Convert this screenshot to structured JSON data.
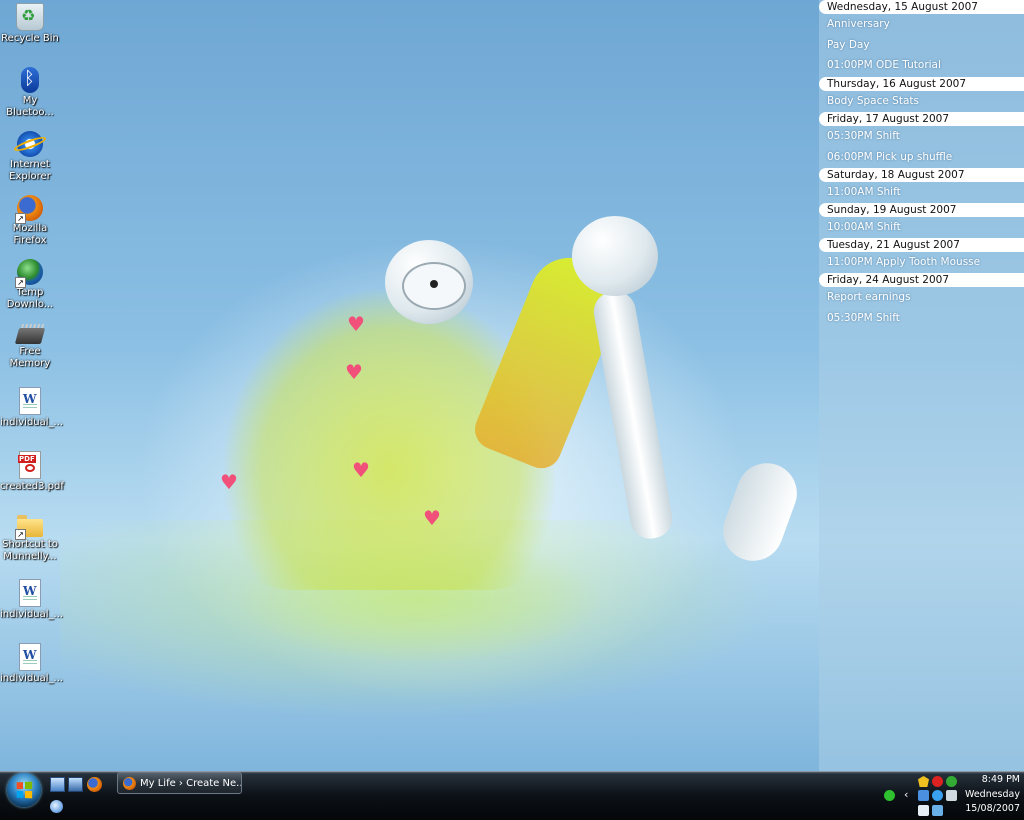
{
  "desktop_icons": [
    {
      "label": "Recycle Bin",
      "icon": "recycle-bin-icon"
    },
    {
      "label": "My\nBluetoo...",
      "icon": "bluetooth-icon"
    },
    {
      "label": "Internet\nExplorer",
      "icon": "internet-explorer-icon"
    },
    {
      "label": "Mozilla\nFirefox",
      "icon": "firefox-icon"
    },
    {
      "label": "Temp\nDownlo...",
      "icon": "globe-icon"
    },
    {
      "label": "Free Memory",
      "icon": "memory-chip-icon"
    },
    {
      "label": "individual_...",
      "icon": "word-document-icon"
    },
    {
      "label": "created3.pdf",
      "icon": "pdf-document-icon"
    },
    {
      "label": "Shortcut to\nMunnelly...",
      "icon": "folder-icon"
    },
    {
      "label": "individual_...",
      "icon": "word-document-icon"
    },
    {
      "label": "individual_...",
      "icon": "word-document-icon"
    }
  ],
  "calendar": [
    {
      "date": "Wednesday, 15 August 2007",
      "events": [
        "Anniversary",
        "Pay Day",
        "01:00PM ODE Tutorial"
      ]
    },
    {
      "date": "Thursday, 16 August 2007",
      "events": [
        "Body Space Stats"
      ]
    },
    {
      "date": "Friday, 17 August 2007",
      "events": [
        "05:30PM Shift",
        "06:00PM Pick up shuffle"
      ]
    },
    {
      "date": "Saturday, 18 August 2007",
      "events": [
        "11:00AM Shift"
      ]
    },
    {
      "date": "Sunday, 19 August 2007",
      "events": [
        "10:00AM Shift"
      ]
    },
    {
      "date": "Tuesday, 21 August 2007",
      "events": [
        "11:00PM Apply Tooth Mousse"
      ]
    },
    {
      "date": "Friday, 24 August 2007",
      "events": [
        "Report earnings",
        "05:30PM Shift"
      ]
    }
  ],
  "taskbar": {
    "task_button_label": "My Life › Create Ne...",
    "tray_chevron": "‹",
    "clock_time": "8:49 PM",
    "clock_day": "Wednesday",
    "clock_date": "15/08/2007"
  }
}
